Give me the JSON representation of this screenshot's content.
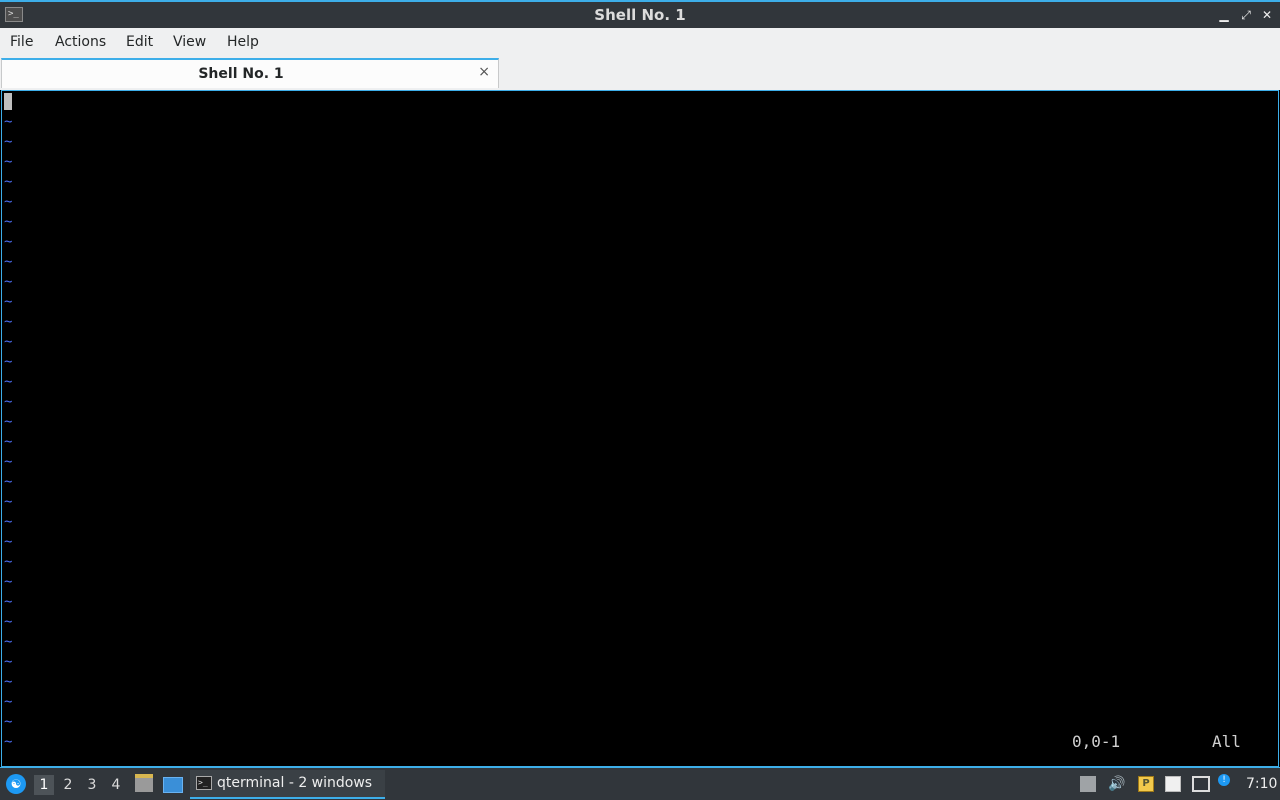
{
  "window": {
    "title": "Shell No. 1",
    "app_icon": ">_",
    "minimize_icon": "▁",
    "maximize_icon": "⤢",
    "close_icon": "✕"
  },
  "menu": {
    "items": [
      "File",
      "Actions",
      "Edit",
      "View",
      "Help"
    ]
  },
  "tabs": [
    {
      "label": "Shell No. 1",
      "close": "×"
    }
  ],
  "terminal": {
    "tilde_rows": [
      "~",
      "~",
      "~",
      "~",
      "~",
      "~",
      "~",
      "~",
      "~",
      "~",
      "~",
      "~",
      "~",
      "~",
      "~",
      "~",
      "~",
      "~",
      "~",
      "~",
      "~",
      "~",
      "~",
      "~",
      "~",
      "~",
      "~",
      "~",
      "~",
      "~",
      "~",
      "~"
    ],
    "cursor_position": "0,0-1",
    "scroll_state": "All",
    "tilde_color": "#4a6cf0",
    "accent_color": "#3daee9"
  },
  "taskbar": {
    "start_icon": "start-menu-icon",
    "start_glyph": "☯",
    "workspaces": [
      "1",
      "2",
      "3",
      "4"
    ],
    "active_workspace": "1",
    "task_label": "qterminal - 2 windows",
    "task_icon": ">_",
    "tray": {
      "volume_glyph": "🔊",
      "clipboard_glyph": "P",
      "info_glyph": "!"
    },
    "clock": "7:10"
  }
}
